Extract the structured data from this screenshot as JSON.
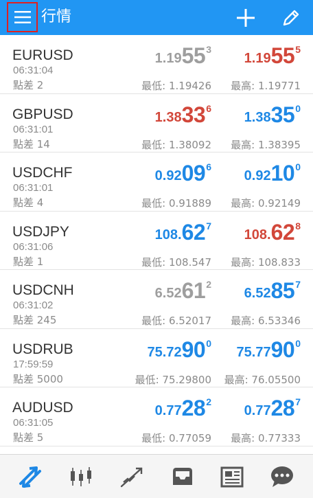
{
  "header": {
    "title": "行情",
    "menu_icon": "hamburger-menu-icon",
    "add_icon": "plus-icon",
    "edit_icon": "pencil-icon"
  },
  "quotes": [
    {
      "symbol": "EURUSD",
      "time": "06:31:04",
      "spread": "點差 2",
      "bid": {
        "small": "1.19",
        "big": "55",
        "sup": "3",
        "color": "gray"
      },
      "ask": {
        "small": "1.19",
        "big": "55",
        "sup": "5",
        "color": "red"
      },
      "low": "最低: 1.19426",
      "high": "最高: 1.19771"
    },
    {
      "symbol": "GBPUSD",
      "time": "06:31:01",
      "spread": "點差 14",
      "bid": {
        "small": "1.38",
        "big": "33",
        "sup": "6",
        "color": "red"
      },
      "ask": {
        "small": "1.38",
        "big": "35",
        "sup": "0",
        "color": "blue"
      },
      "low": "最低: 1.38092",
      "high": "最高: 1.38395"
    },
    {
      "symbol": "USDCHF",
      "time": "06:31:01",
      "spread": "點差 4",
      "bid": {
        "small": "0.92",
        "big": "09",
        "sup": "6",
        "color": "blue"
      },
      "ask": {
        "small": "0.92",
        "big": "10",
        "sup": "0",
        "color": "blue"
      },
      "low": "最低: 0.91889",
      "high": "最高: 0.92149"
    },
    {
      "symbol": "USDJPY",
      "time": "06:31:06",
      "spread": "點差 1",
      "bid": {
        "small": "108.",
        "big": "62",
        "sup": "7",
        "color": "blue"
      },
      "ask": {
        "small": "108.",
        "big": "62",
        "sup": "8",
        "color": "red"
      },
      "low": "最低: 108.547",
      "high": "最高: 108.833"
    },
    {
      "symbol": "USDCNH",
      "time": "06:31:02",
      "spread": "點差 245",
      "bid": {
        "small": "6.52",
        "big": "61",
        "sup": "2",
        "color": "gray"
      },
      "ask": {
        "small": "6.52",
        "big": "85",
        "sup": "7",
        "color": "blue"
      },
      "low": "最低: 6.52017",
      "high": "最高: 6.53346"
    },
    {
      "symbol": "USDRUB",
      "time": "17:59:59",
      "spread": "點差 5000",
      "bid": {
        "small": "75.72",
        "big": "90",
        "sup": "0",
        "color": "blue"
      },
      "ask": {
        "small": "75.77",
        "big": "90",
        "sup": "0",
        "color": "blue"
      },
      "low": "最低: 75.29800",
      "high": "最高: 76.05500"
    },
    {
      "symbol": "AUDUSD",
      "time": "06:31:05",
      "spread": "點差 5",
      "bid": {
        "small": "0.77",
        "big": "28",
        "sup": "2",
        "color": "blue"
      },
      "ask": {
        "small": "0.77",
        "big": "28",
        "sup": "7",
        "color": "blue"
      },
      "low": "最低: 0.77059",
      "high": "最高: 0.77333"
    }
  ],
  "bottom_nav": [
    {
      "name": "quotes-tab",
      "icon": "arrows-updown-icon",
      "active": true
    },
    {
      "name": "chart-tab",
      "icon": "candlestick-icon",
      "active": false
    },
    {
      "name": "trade-tab",
      "icon": "trend-line-icon",
      "active": false
    },
    {
      "name": "history-tab",
      "icon": "inbox-tray-icon",
      "active": false
    },
    {
      "name": "news-tab",
      "icon": "newspaper-icon",
      "active": false
    },
    {
      "name": "chat-tab",
      "icon": "chat-bubble-icon",
      "active": false
    }
  ],
  "colors": {
    "appbar": "#2196f3",
    "blue": "#1e88e5",
    "red": "#d2473a",
    "gray": "#9e9e9e",
    "nav_active": "#1e88e5",
    "nav_inactive": "#555555"
  }
}
